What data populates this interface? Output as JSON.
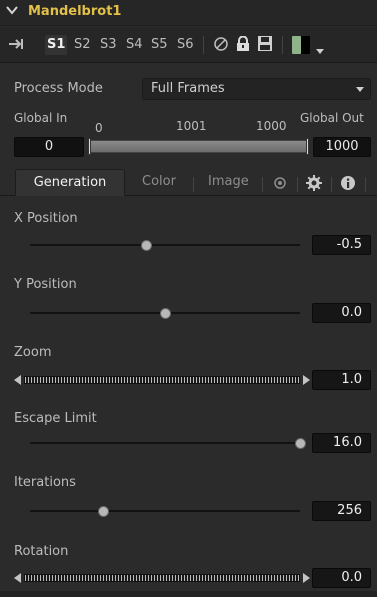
{
  "tool": {
    "title": "Mandelbrot1"
  },
  "toolbar": {
    "slots": [
      "S1",
      "S2",
      "S3",
      "S4",
      "S5",
      "S6"
    ],
    "selected_slot": "S1",
    "icons": [
      "pin-icon",
      "disable-icon",
      "lock-icon",
      "save-icon",
      "color-swatch-icon",
      "dropdown-arrow-icon"
    ]
  },
  "process_mode": {
    "label": "Process Mode",
    "value": "Full Frames"
  },
  "global_range": {
    "global_in_label": "Global In",
    "global_out_label": "Global Out",
    "range_start": "0",
    "range_mid": "1001",
    "range_end": "1000",
    "in_value": "0",
    "out_value": "1000"
  },
  "tabs": [
    {
      "label": "Generation",
      "active": true
    },
    {
      "label": "Color",
      "active": false
    },
    {
      "label": "Image",
      "active": false
    }
  ],
  "tab_icons": [
    "settings-icon",
    "gear-icon",
    "info-icon"
  ],
  "controls": [
    {
      "label": "X Position",
      "type": "slider",
      "value": "-0.5",
      "level": 0.43
    },
    {
      "label": "Y Position",
      "type": "slider",
      "value": "0.0",
      "level": 0.5
    },
    {
      "label": "Zoom",
      "type": "jog",
      "value": "1.0"
    },
    {
      "label": "Escape Limit",
      "type": "slider",
      "value": "16.0",
      "level": 1.0
    },
    {
      "label": "Iterations",
      "type": "slider",
      "value": "256",
      "level": 0.27
    },
    {
      "label": "Rotation",
      "type": "jog",
      "value": "0.0"
    }
  ],
  "colors": {
    "title": "#e2c04a",
    "background": "#2b2b2b",
    "swatch_green": "#8fb48a",
    "swatch_black": "#000000"
  }
}
